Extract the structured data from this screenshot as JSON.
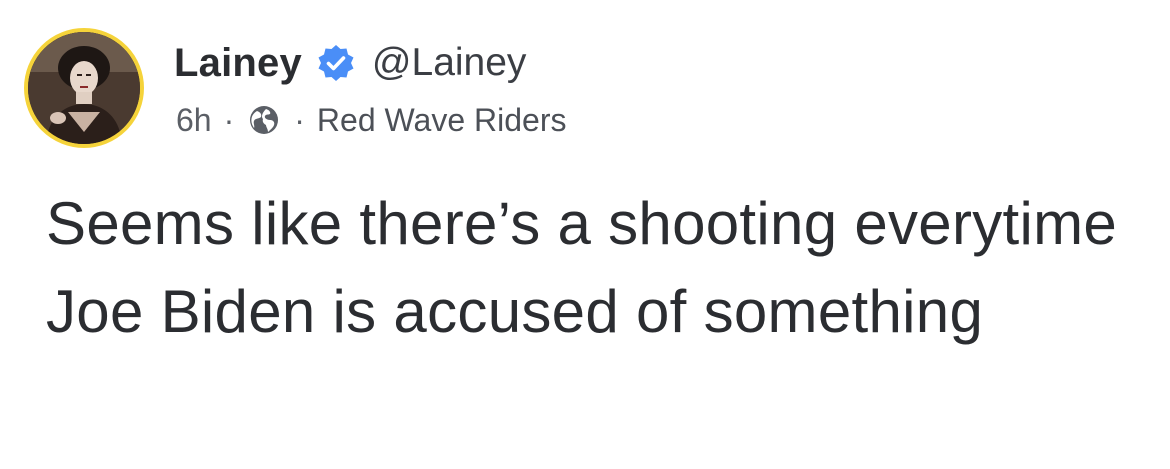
{
  "post": {
    "author_name": "Lainey",
    "handle": "@Lainey",
    "time": "6h",
    "separator": "·",
    "audience_icon": "globe-icon",
    "group": "Red Wave Riders",
    "text": "Seems like there’s a shooting everytime Joe Biden is accused of something"
  },
  "colors": {
    "avatar_ring": "#f5d33a",
    "verified_badge": "#4a8ef7",
    "text": "#2b2d31",
    "meta_text": "#5b5f66"
  }
}
